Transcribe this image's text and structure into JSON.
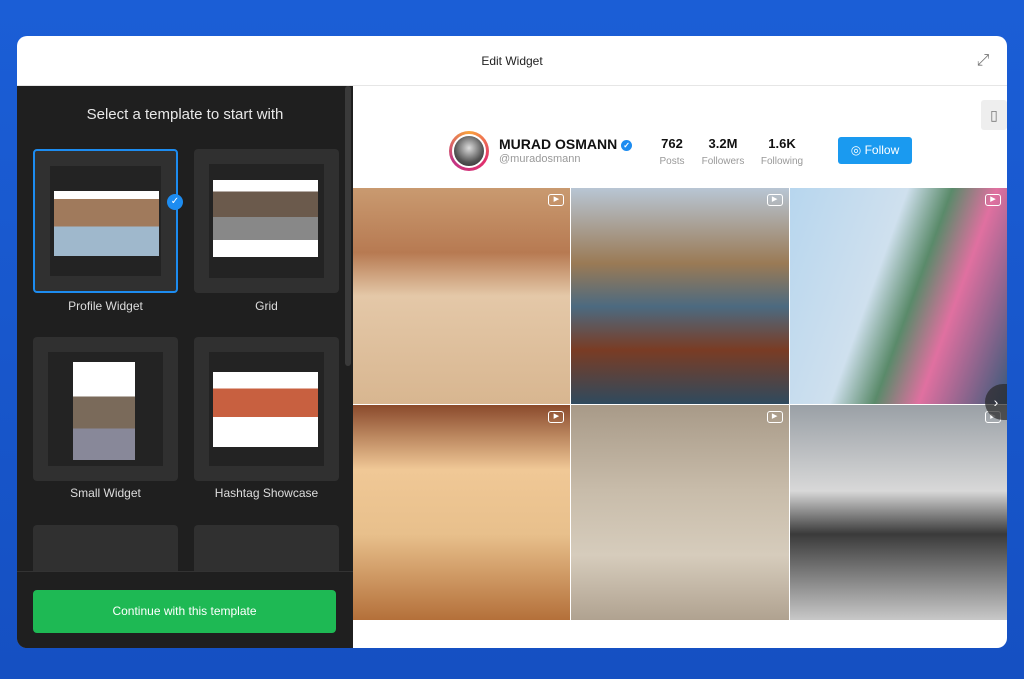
{
  "window": {
    "title": "Edit Widget"
  },
  "sidebar": {
    "heading": "Select a template to start with",
    "templates": [
      {
        "label": "Profile Widget",
        "selected": true
      },
      {
        "label": "Grid"
      },
      {
        "label": "Small Widget"
      },
      {
        "label": "Hashtag Showcase"
      }
    ],
    "continue_label": "Continue with this template"
  },
  "profile": {
    "name": "MURAD OSMANN",
    "handle": "@muradosmann",
    "stats": [
      {
        "value": "762",
        "label": "Posts"
      },
      {
        "value": "3.2M",
        "label": "Followers"
      },
      {
        "value": "1.6K",
        "label": "Following"
      }
    ],
    "follow_label": "Follow"
  },
  "colors": {
    "accent": "#1a9af0",
    "continue": "#1eb954",
    "background": "#1b5ed6"
  }
}
